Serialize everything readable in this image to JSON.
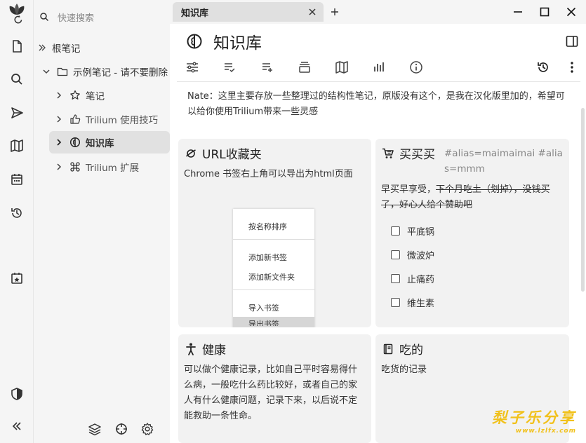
{
  "search": {
    "placeholder": "快速搜索"
  },
  "tree": {
    "root": "根笔记",
    "demo": "示例笔记 - 请不要删除",
    "items": [
      {
        "label": "笔记",
        "icon": "star-icon"
      },
      {
        "label": "Trilium 使用技巧",
        "icon": "thumbs-up-icon"
      },
      {
        "label": "知识库",
        "icon": "brain-icon"
      },
      {
        "label": "Trilium 扩展",
        "icon": "command-icon"
      }
    ]
  },
  "tab": {
    "title": "知识库"
  },
  "note": {
    "title": "知识库",
    "description": "Nate：这里主要存放一些整理过的结构性笔记，原版没有这个，是我在汉化版里加的，希望可以给你使用Trilium带来一些灵感"
  },
  "cards": {
    "url": {
      "title": "URL收藏夹",
      "text": "Chrome 书签右上角可以导出为html页面",
      "menu": [
        "按名称排序",
        "添加新书签",
        "添加新文件夹",
        "导入书签",
        "导出书签"
      ]
    },
    "buy": {
      "title": "买买买",
      "alias": "#alias=maimaimai #alias=mmm",
      "text_plain": "早买早享受，",
      "text_strike": "下个月吃土（划掉），没钱买了，好心人给个赞助吧",
      "items": [
        "平底锅",
        "微波炉",
        "止痛药",
        "维生素"
      ]
    },
    "health": {
      "title": "健康",
      "text": "可以做个健康记录，比如自己平时容易得什么病，一般吃什么药比较好，或者自己的家人有什么健康问题，记录下来，以后说不定能救助一条性命。"
    },
    "food": {
      "title": "吃的",
      "text": "吃货的记录"
    }
  },
  "watermark": {
    "line1": "梨子乐分享",
    "line2": "www.lzlfx.com"
  }
}
